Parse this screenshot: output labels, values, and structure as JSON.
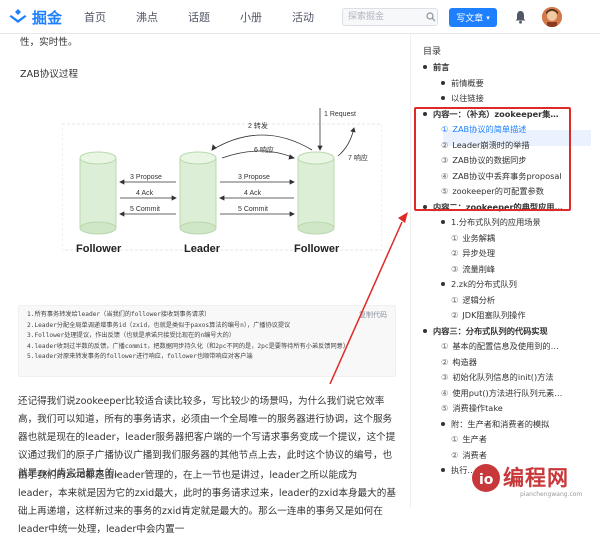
{
  "header": {
    "logo_text": "掘金",
    "nav": [
      "首页",
      "沸点",
      "话题",
      "小册",
      "活动"
    ],
    "search_placeholder": "探索掘金",
    "write_button": "写文章",
    "write_caret": "▾",
    "bell_icon": "bell-icon",
    "accent": "#1e80ff"
  },
  "article": {
    "top_line": "性，实时性。",
    "section_title": "ZAB协议过程",
    "diagram": {
      "nodes": [
        "Follower",
        "Leader",
        "Follower"
      ],
      "left_arrows": [
        "3 Propose",
        "4 Ack",
        "5 Commit"
      ],
      "right_arrows": [
        "3 Propose",
        "4 Ack",
        "5 Commit"
      ],
      "top_labels": [
        "1 Request",
        "2 转发",
        "6 响应",
        "7 响应"
      ]
    },
    "code": {
      "copy_label": "复制代码",
      "lines": [
        "1.所有事务转发给leader（当我们的follower接收到事务请求）",
        "2.Leader分配全局单调递增事务id（zxid，也就是类似于paxos算法的编号n），广播协议提议",
        "3.Follower处理提议，作出反馈（也就是承诺只接受比现在的n编号大的）",
        "4.leader收到过半数的反馈，广播commit，把数据同步持久化（和2pc不同的是，2pc是要等待所有小弟反馈同意）",
        "5.leader对原来转发事务的follower进行响应，follower也顺带响应对客户端"
      ]
    },
    "para1": "还记得我们说zookeeper比较适合读比较多，写比较少的场景吗，为什么我们说它效率高，我们可以知道，所有的事务请求，必须由一个全局唯一的服务器进行协调，这个服务器也就是现在的leader，leader服务器把客户端的一个写请求事务变成一个提议，这个提议通过我们的原子广播协议广播到我们服务器的其他节点上去，此时这个协议的编号，也就是zxid肯定是最大的。",
    "para2": "由于我们的zxid都是由leader管理的，在上一节也是讲过，leader之所以能成为leader，本来就是因为它的zxid最大，此时的事务请求过来，leader的zxid本身最大的基础上再递增，这样新过来的事务的zxid肯定就是最大的。那么一连串的事务又是如何在leader中统一处理，leader中会内置一"
  },
  "toc": {
    "title": "目录",
    "items": [
      {
        "level": 1,
        "label": "前言",
        "bold": true
      },
      {
        "level": 2,
        "label": "前情概要"
      },
      {
        "level": 2,
        "label": "以往链接"
      },
      {
        "level": 1,
        "label": "内容一：（补充）zookeeper集…",
        "bold": true
      },
      {
        "level": 2,
        "label": "ZAB协议的简单描述",
        "num": "①",
        "active": true
      },
      {
        "level": 2,
        "label": "Leader崩溃时的举措",
        "num": "②"
      },
      {
        "level": 2,
        "label": "ZAB协议的数据同步",
        "num": "③"
      },
      {
        "level": 2,
        "label": "ZAB协议中丢弃事务proposal",
        "num": "④"
      },
      {
        "level": 2,
        "label": "zookeeper的可配置参数",
        "num": "⑤"
      },
      {
        "level": 1,
        "label": "内容二：zookeeper的典型应用…",
        "bold": true
      },
      {
        "level": 2,
        "label": "1.分布式队列的应用场景"
      },
      {
        "level": 3,
        "label": "业务解耦",
        "num": "①"
      },
      {
        "level": 3,
        "label": "异步处理",
        "num": "②"
      },
      {
        "level": 3,
        "label": "流量削峰",
        "num": "③"
      },
      {
        "level": 2,
        "label": "2.zk的分布式队列"
      },
      {
        "level": 3,
        "label": "逻辑分析",
        "num": "①"
      },
      {
        "level": 3,
        "label": "JDK阻塞队列操作",
        "num": "②"
      },
      {
        "level": 1,
        "label": "内容三：分布式队列的代码实现",
        "bold": true
      },
      {
        "level": 2,
        "label": "基本的配置信息及使用到的…",
        "num": "①"
      },
      {
        "level": 2,
        "label": "构造器",
        "num": "②"
      },
      {
        "level": 2,
        "label": "初始化队列信息的init()方法",
        "num": "③"
      },
      {
        "level": 2,
        "label": "使用put()方法进行队列元素…",
        "num": "④"
      },
      {
        "level": 2,
        "label": "消费操作take",
        "num": "⑤"
      },
      {
        "level": 2,
        "label": "附：生产者和消费者的模拟"
      },
      {
        "level": 3,
        "label": "生产者",
        "num": "①"
      },
      {
        "level": 3,
        "label": "消费者",
        "num": "②"
      },
      {
        "level": 2,
        "label": "执行…"
      }
    ]
  },
  "watermark": {
    "text": "编程网",
    "sub": "pianchengwang.com"
  }
}
